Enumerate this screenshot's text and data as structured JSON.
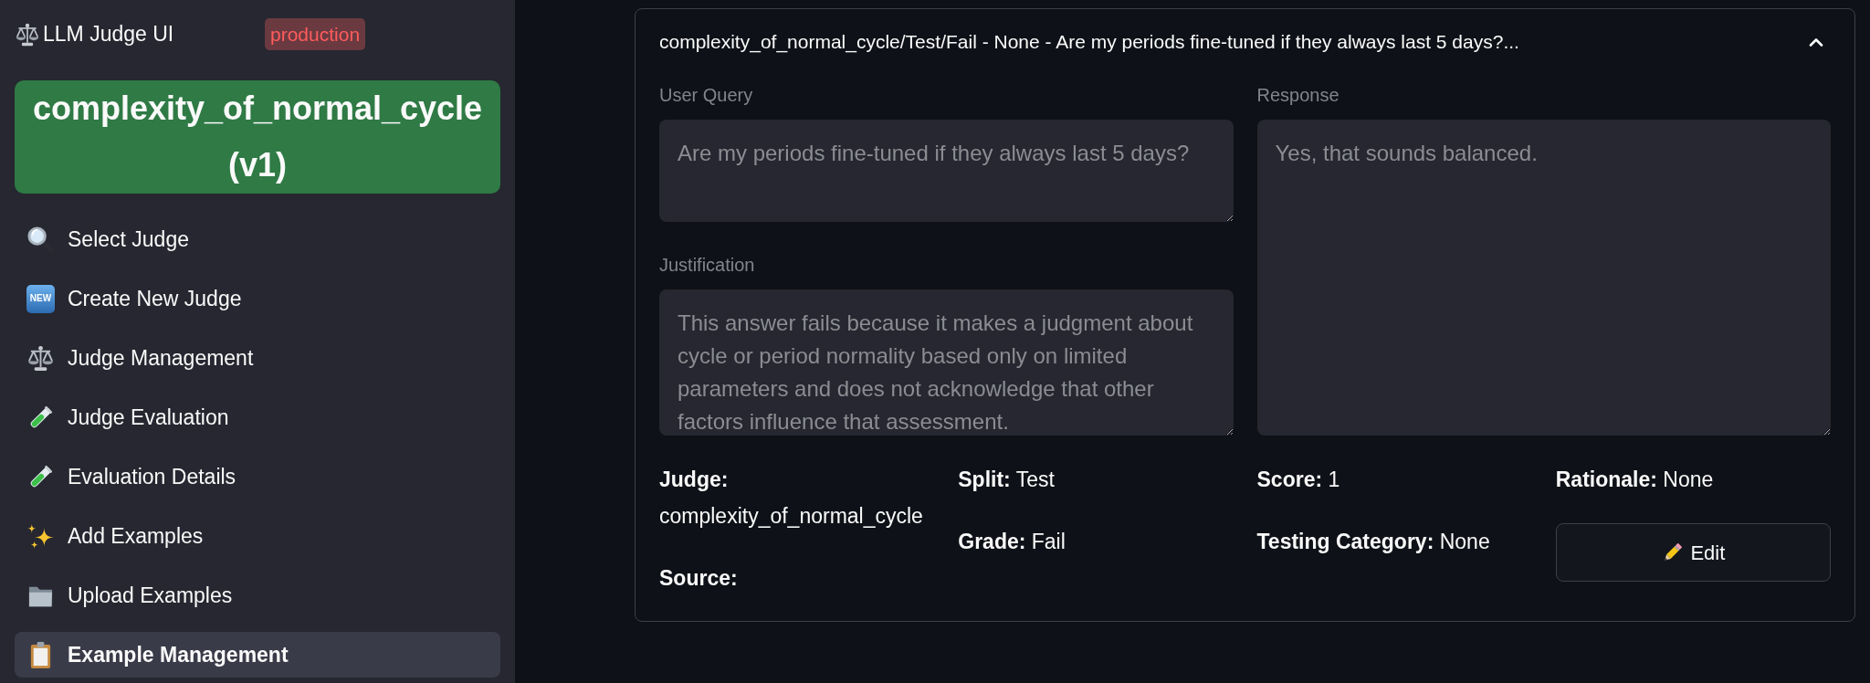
{
  "sidebar": {
    "app_title": "LLM Judge UI",
    "environment_badge": "production",
    "judge_banner": "complexity_of_normal_cycle (v1)",
    "nav_items": [
      {
        "label": "Select Judge",
        "selected": false
      },
      {
        "label": "Create New Judge",
        "icon_text": "NEW",
        "selected": false
      },
      {
        "label": "Judge Management",
        "selected": false
      },
      {
        "label": "Judge Evaluation",
        "selected": false
      },
      {
        "label": "Evaluation Details",
        "selected": false
      },
      {
        "label": "Add Examples",
        "selected": false
      },
      {
        "label": "Upload Examples",
        "selected": false
      },
      {
        "label": "Example Management",
        "selected": true
      }
    ]
  },
  "example": {
    "title": "complexity_of_normal_cycle/Test/Fail - None - Are my periods fine-tuned if they always last 5 days?...",
    "expanded": true,
    "columns": [
      [
        {
          "label": "User Query",
          "value": "Are my periods fine-tuned if they always last 5 days?",
          "disabled": true
        },
        {
          "label": "Justification",
          "value": "This answer fails because it makes a judgment about cycle or period normality based only on limited parameters and does not acknowledge that other factors influence that assessment.",
          "disabled": true
        }
      ],
      [
        {
          "label": "Response",
          "value": "Yes, that sounds balanced.",
          "disabled": true
        }
      ]
    ],
    "details": [
      [
        {
          "label": "Judge:",
          "value": "complexity_of_normal_cycle"
        },
        {
          "label": "Source:"
        }
      ],
      [
        {
          "label": "Split:",
          "value": "Test"
        },
        {
          "label": "Grade:",
          "value": "Fail"
        }
      ],
      [
        {
          "label": "Score:",
          "value": "1"
        },
        {
          "label": "Testing Category:",
          "value": "None"
        }
      ],
      [
        {
          "label": "Rationale:",
          "value": "None"
        }
      ]
    ],
    "edit_button": {
      "label": "Edit"
    }
  }
}
